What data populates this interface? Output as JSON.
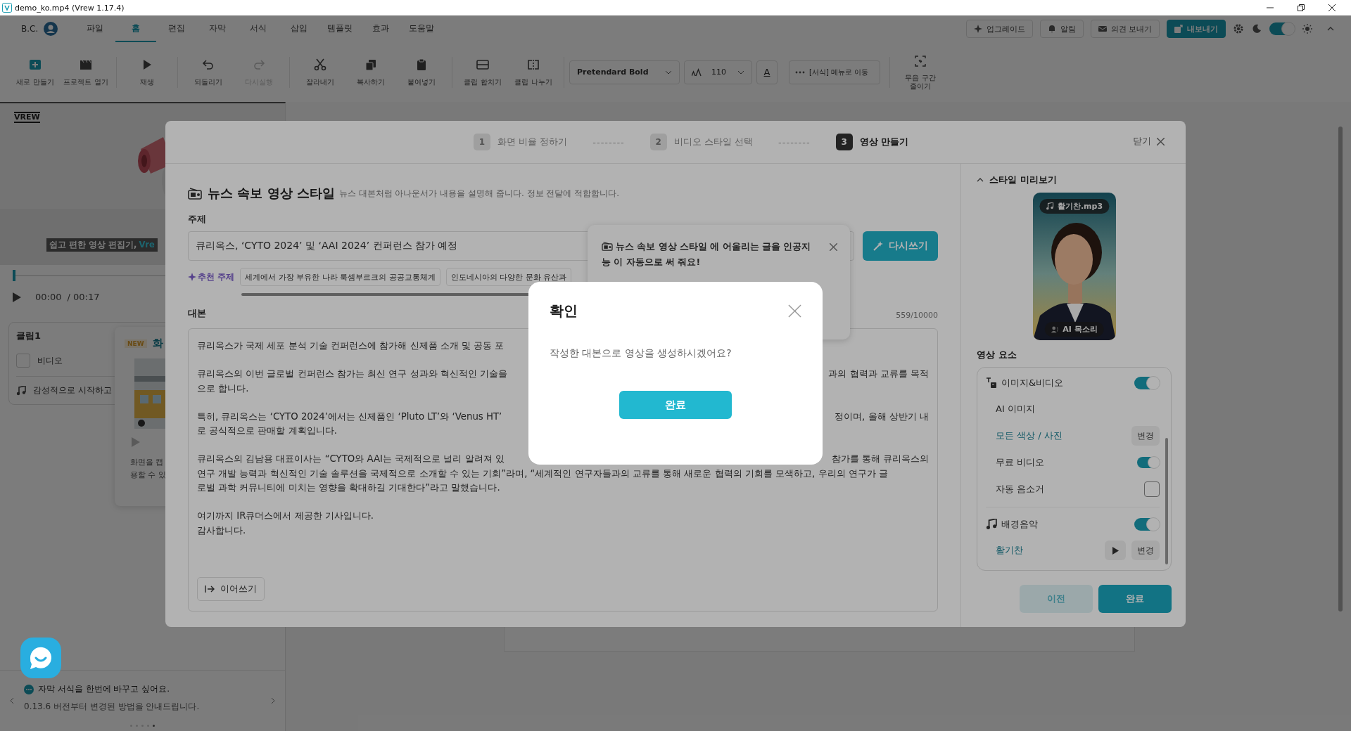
{
  "title_bar": {
    "title": "demo_ko.mp4 (Vrew 1.17.4)"
  },
  "menu_bar": {
    "user": "B.C.",
    "tabs": [
      {
        "label": "파일",
        "selected": false
      },
      {
        "label": "홈",
        "selected": true
      },
      {
        "label": "편집",
        "selected": false
      },
      {
        "label": "자막",
        "selected": false
      },
      {
        "label": "서식",
        "selected": false
      },
      {
        "label": "삽입",
        "selected": false
      },
      {
        "label": "템플릿",
        "selected": false
      },
      {
        "label": "효과",
        "selected": false
      },
      {
        "label": "도움말",
        "selected": false
      }
    ],
    "actions": [
      {
        "label": "업그레이드",
        "kind": "upgrade"
      },
      {
        "label": "알림",
        "kind": "bell"
      },
      {
        "label": "의견 보내기",
        "kind": "mail"
      },
      {
        "label": "내보내기",
        "kind": "export"
      }
    ],
    "dark_mode": {
      "on": true
    }
  },
  "toolbar": {
    "groups": [
      [
        {
          "label": "새로 만들기",
          "kind": "plus",
          "disabled": false
        },
        {
          "label": "프로젝트 열기",
          "kind": "clapper",
          "disabled": false
        }
      ],
      [
        {
          "label": "재생",
          "kind": "play",
          "disabled": false
        }
      ],
      [
        {
          "label": "되돌리기",
          "kind": "undo",
          "disabled": false
        },
        {
          "label": "다시실행",
          "kind": "redo",
          "disabled": true
        }
      ],
      [
        {
          "label": "잘라내기",
          "kind": "cut",
          "disabled": false
        },
        {
          "label": "복사하기",
          "kind": "copy",
          "disabled": false
        },
        {
          "label": "붙여넣기",
          "kind": "paste",
          "disabled": false
        }
      ],
      [
        {
          "label": "클립 합치기",
          "kind": "merge",
          "disabled": false
        },
        {
          "label": "클립 나누기",
          "kind": "split",
          "disabled": false
        }
      ]
    ],
    "font": "Pretendard Bold",
    "size": "110",
    "text_color": "A",
    "format_link": "[서식] 메뉴로 이동",
    "silence": "무음 구간 줄이기"
  },
  "left_panel": {
    "logo": "VREW",
    "caption": {
      "text": "쉽고 편한 영상 편집기,",
      "highlight": "Vre"
    },
    "player": {
      "level": 0,
      "time": "00:00",
      "duration": "/ 00:17"
    },
    "clip": {
      "title": "클립1",
      "video": {
        "label": "비디오",
        "checked": false
      },
      "music": "감성적으로 시작하고"
    },
    "news_card": {
      "badge": "NEW",
      "title": "화",
      "lines": [
        "화면을 캡",
        "용할 수 있"
      ]
    },
    "tip": {
      "title": "자막 서식을 한번에 바꾸고 싶어요.",
      "body": "0.13.6 버전부터 변경된 방법을 안내드립니다.",
      "pages": [
        {
          "selected": false
        },
        {
          "selected": false
        },
        {
          "selected": false
        },
        {
          "selected": false
        },
        {
          "selected": true
        }
      ]
    }
  },
  "wizard": {
    "steps": [
      {
        "number": "1",
        "label": "화면 비율 정하기",
        "selected": false
      },
      {
        "number": "2",
        "label": "비디오 스타일 선택",
        "selected": false
      },
      {
        "number": "3",
        "label": "영상 만들기",
        "selected": true
      }
    ],
    "separators": [
      "--------",
      "--------"
    ],
    "close": "닫기",
    "style": {
      "title": "뉴스 속보 영상 스타일",
      "description": "뉴스 대본처럼 아나운서가 내용을 설명해 줍니다. 정보 전달에 적합합니다."
    },
    "topic": {
      "label": "주제",
      "value": "큐리옥스, ‘CYTO 2024’ 및 ‘AAI 2024’ 컨퍼런스 참가 예정",
      "rewrite": "다시쓰기"
    },
    "suggestions": {
      "label": "추천 주제",
      "chips": [
        "세계에서 가장 부유한 나라 룩셈부르크의 공공교통체계",
        "인도네시아의 다양한 문화 유산과"
      ]
    },
    "script": {
      "label": "대본",
      "count": "559/10000",
      "paragraphs": [
        [
          {
            "left": "큐리옥스가 국제 세포 분석 기술 컨퍼런스에 참가해 신제품 소개 및 공동 포"
          }
        ],
        [
          {
            "left": "큐리옥스의 이번 글로벌 컨퍼런스 참가는 최신 연구 성과와 혁신적인 기술을",
            "right": "과의 협력과 교류를 목적"
          },
          {
            "left": "으로 합니다."
          }
        ],
        [
          {
            "left": "특히, 큐리옥스는 ‘CYTO 2024’에서는 신제품인 ‘Pluto LT’와 ‘Venus HT’",
            "right": "정이며, 올해 상반기 내"
          },
          {
            "left": "로 공식적으로 판매할 계획입니다."
          }
        ],
        [
          {
            "left": "큐리옥스의 김남용 대표이사는 “CYTO와 AAI는 국제적으로 널리 알려져 있",
            "right": "참가를 통해 큐리옥스의"
          },
          {
            "left": "연구 개발 능력과 혁신적인 기술 솔루션을 국제적으로 소개할 수 있는 기회”라며, “세계적인 연구자들과의 교류를 통해 새로운 협력의 기회를 모색하고, 우리의 연구가 글"
          },
          {
            "left": "로벌 과학 커뮤니티에 미치는 영향을 확대하길 기대한다”라고 말했습니다."
          }
        ],
        [
          {
            "left": "여기까지 IR큐더스에서 제공한 기사입니다."
          },
          {
            "left": "감사합니다."
          }
        ]
      ],
      "continue": "이어쓰기"
    },
    "popover": {
      "text": "뉴스 속보 영상 스타일 에 어울리는 글을 인공지능 이 자동으로 써 줘요!"
    },
    "preview": {
      "title": "스타일 미리보기",
      "expanded": true,
      "music_badge": "활기찬.mp3",
      "voice_badge": "AI 목소리"
    },
    "elements": {
      "title": "영상 요소",
      "image_video": {
        "label": "이미지&비디오",
        "on": true
      },
      "ai_image": {
        "label": "AI 이미지",
        "value": "모든 색상 / 사진",
        "change": "변경"
      },
      "free_video": {
        "label": "무료 비디오",
        "on": true
      },
      "auto_mute": {
        "label": "자동 음소거",
        "checked": false
      },
      "music": {
        "label": "배경음악",
        "on": true,
        "value": "활기찬",
        "change": "변경"
      }
    },
    "buttons": {
      "prev": {
        "label": "이전",
        "disabled": true
      },
      "done": {
        "label": "완료"
      }
    }
  },
  "confirm": {
    "title": "확인",
    "message": "작성한 대본으로 영상을 생성하시겠어요?",
    "button": "완료"
  }
}
